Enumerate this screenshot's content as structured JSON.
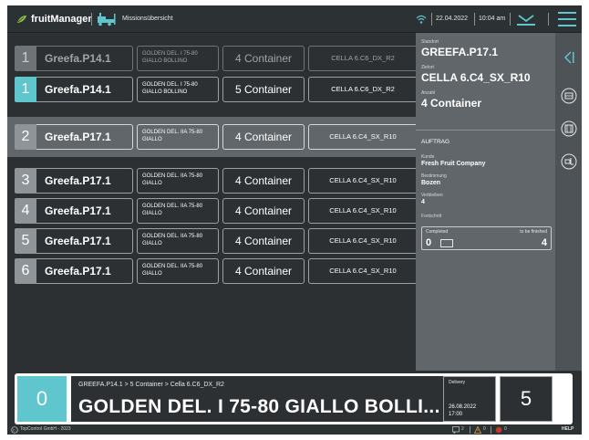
{
  "header": {
    "brand": "fruitManager",
    "mission_label": "Missionsübersicht",
    "date": "22.04.2022",
    "time": "10:04 am"
  },
  "rows": [
    {
      "num": "1",
      "name": "Greefa.P14.1",
      "variety": "GOLDEN DEL. I 75-80 GIALLO BOLLINO",
      "containers": "4 Container",
      "location": "CELLA 6.C6_DX_R2",
      "state": "dim"
    },
    {
      "num": "1",
      "name": "Greefa.P14.1",
      "variety": "GOLDEN DEL. I 75-80 GIALLO BOLLINO",
      "containers": "5 Container",
      "location": "CELLA 6.C6_DX_R2",
      "state": "active"
    },
    {
      "num": "2",
      "name": "Greefa.P17.1",
      "variety": "GOLDEN DEL. IIA 75-80 GIALLO",
      "containers": "4 Container",
      "location": "CELLA 6.C4_SX_R10",
      "state": "selected"
    },
    {
      "num": "3",
      "name": "Greefa.P17.1",
      "variety": "GOLDEN DEL. IIA 75-80 GIALLO",
      "containers": "4 Container",
      "location": "CELLA 6.C4_SX_R10",
      "state": "normal"
    },
    {
      "num": "4",
      "name": "Greefa.P17.1",
      "variety": "GOLDEN DEL. IIA 75-80 GIALLO",
      "containers": "4 Container",
      "location": "CELLA 6.C4_SX_R10",
      "state": "normal"
    },
    {
      "num": "5",
      "name": "Greefa.P17.1",
      "variety": "GOLDEN DEL. IIA 75-80 GIALLO",
      "containers": "4 Container",
      "location": "CELLA 6.C4_SX_R10",
      "state": "normal"
    },
    {
      "num": "6",
      "name": "Greefa.P17.1",
      "variety": "GOLDEN DEL. IIA 75-80 GIALLO",
      "containers": "4 Container",
      "location": "CELLA 6.C4_SX_R10",
      "state": "normal"
    }
  ],
  "info": {
    "standort_label": "Standort",
    "standort": "GREEFA.P17.1",
    "ziel_label": "Zielort",
    "ziel": "CELLA 6.C4_SX_R10",
    "anzahl_label": "Anzahl",
    "anzahl": "4 Container",
    "auftrag_label": "AUFTRAG",
    "kunde_label": "Kunde",
    "kunde": "Fresh Fruit Company",
    "bestimmung_label": "Bestimmung",
    "bestimmung": "Bozen",
    "verbleiben_label": "Verbleiben",
    "verbleiben": "4",
    "fortschritt_label": "Fortschritt",
    "completed_label": "Completed",
    "completed": "0",
    "to_be_finished_label": "to be finished",
    "to_be_finished": "4"
  },
  "bottom": {
    "number": "0",
    "path": "GREEFA.P14.1 > 5 Container > Cella 6.C6_DX_R2",
    "title": "GOLDEN DEL. I 75-80 GIALLO BOLLI...",
    "delivery_label": "Delivery",
    "delivery_date": "26.08.2022",
    "delivery_time": "17:00",
    "quantity": "5"
  },
  "status": {
    "copyright": "TopControl GmbH - 2023",
    "messages": "2",
    "warnings": "0",
    "errors": "0",
    "help": "HELP"
  },
  "colors": {
    "accent": "#5ec6cc",
    "panel": "#60666a",
    "background": "#2d3033",
    "warning": "#e8a23c",
    "error": "#c0392b"
  }
}
